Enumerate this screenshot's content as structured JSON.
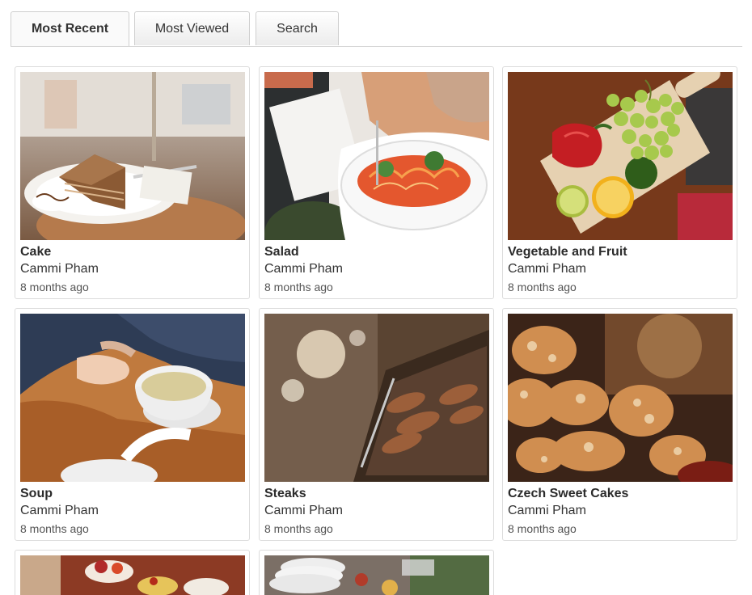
{
  "tabs": [
    {
      "label": "Most Recent",
      "active": true
    },
    {
      "label": "Most Viewed",
      "active": false
    },
    {
      "label": "Search",
      "active": false
    }
  ],
  "items": [
    {
      "title": "Cake",
      "author": "Cammi Pham",
      "time": "8 months ago",
      "image": "cake-photo"
    },
    {
      "title": "Salad",
      "author": "Cammi Pham",
      "time": "8 months ago",
      "image": "salad-photo"
    },
    {
      "title": "Vegetable and Fruit",
      "author": "Cammi Pham",
      "time": "8 months ago",
      "image": "vegetable-fruit-photo"
    },
    {
      "title": "Soup",
      "author": "Cammi Pham",
      "time": "8 months ago",
      "image": "soup-photo"
    },
    {
      "title": "Steaks",
      "author": "Cammi Pham",
      "time": "8 months ago",
      "image": "steaks-photo"
    },
    {
      "title": "Czech Sweet Cakes",
      "author": "Cammi Pham",
      "time": "8 months ago",
      "image": "sweet-cakes-photo"
    },
    {
      "image": "buffet-photo"
    },
    {
      "image": "plates-photo"
    }
  ]
}
